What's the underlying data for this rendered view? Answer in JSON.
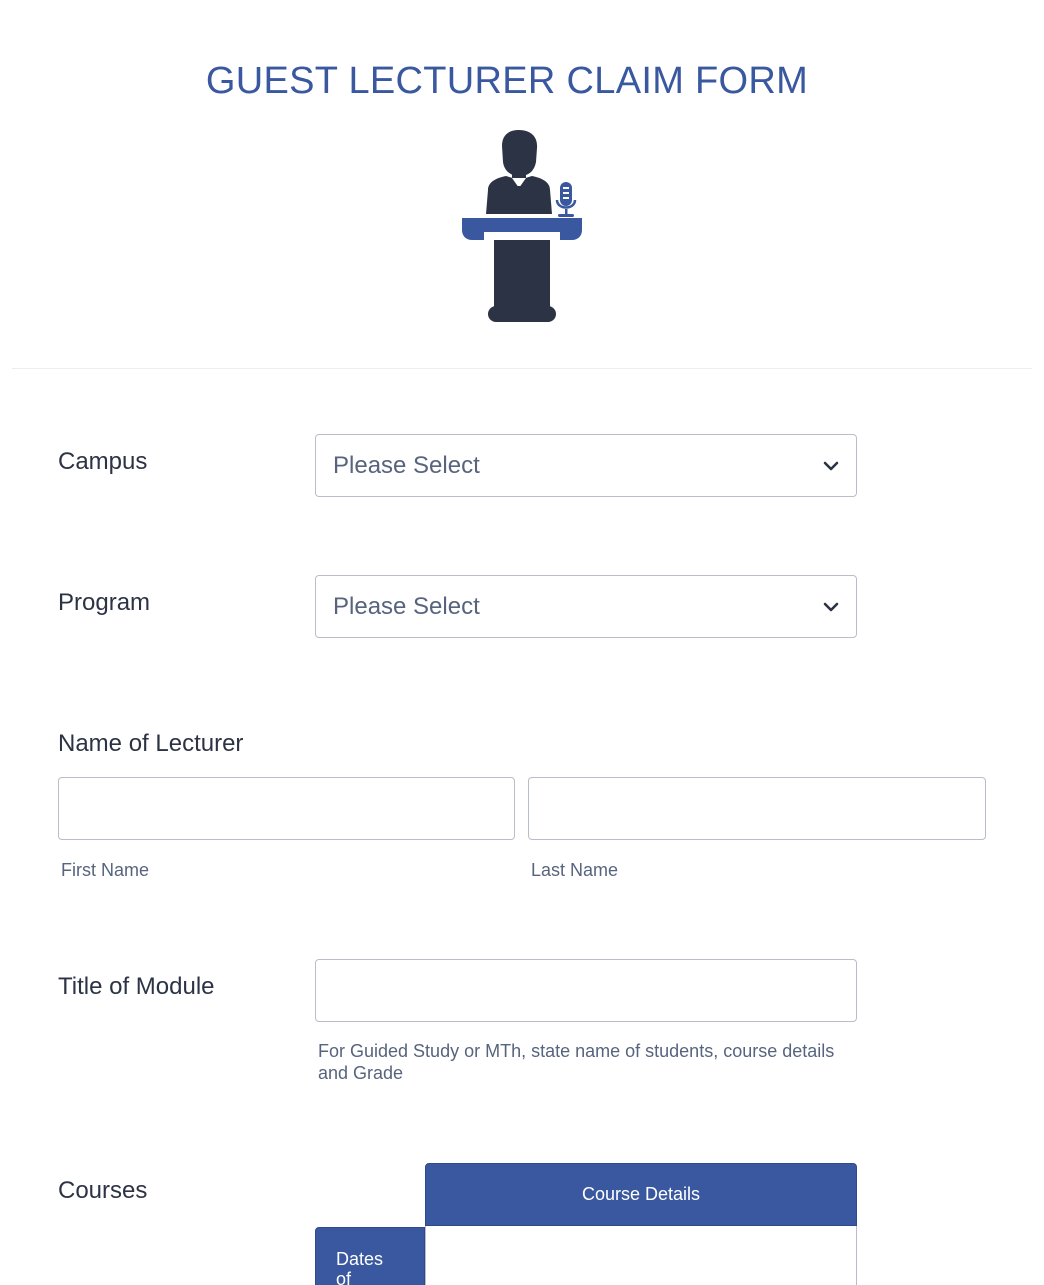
{
  "form": {
    "title": "GUEST LECTURER CLAIM FORM",
    "header_icon": "podium-speaker-icon"
  },
  "colors": {
    "accent": "#3a58a0",
    "text": "#2c3345",
    "muted": "#57647e",
    "border": "#b8bdc9"
  },
  "fields": {
    "campus": {
      "label": "Campus",
      "value": "Please Select"
    },
    "program": {
      "label": "Program",
      "value": "Please Select"
    },
    "lecturer": {
      "label": "Name of Lecturer",
      "first_value": "",
      "last_value": "",
      "first_sublabel": "First Name",
      "last_sublabel": "Last Name"
    },
    "module": {
      "label": "Title of Module",
      "value": "",
      "help": "For Guided Study or MTh, state name of students, course details and Grade"
    },
    "courses": {
      "label": "Courses",
      "column_header": "Course Details",
      "row_header": "Dates of"
    }
  }
}
